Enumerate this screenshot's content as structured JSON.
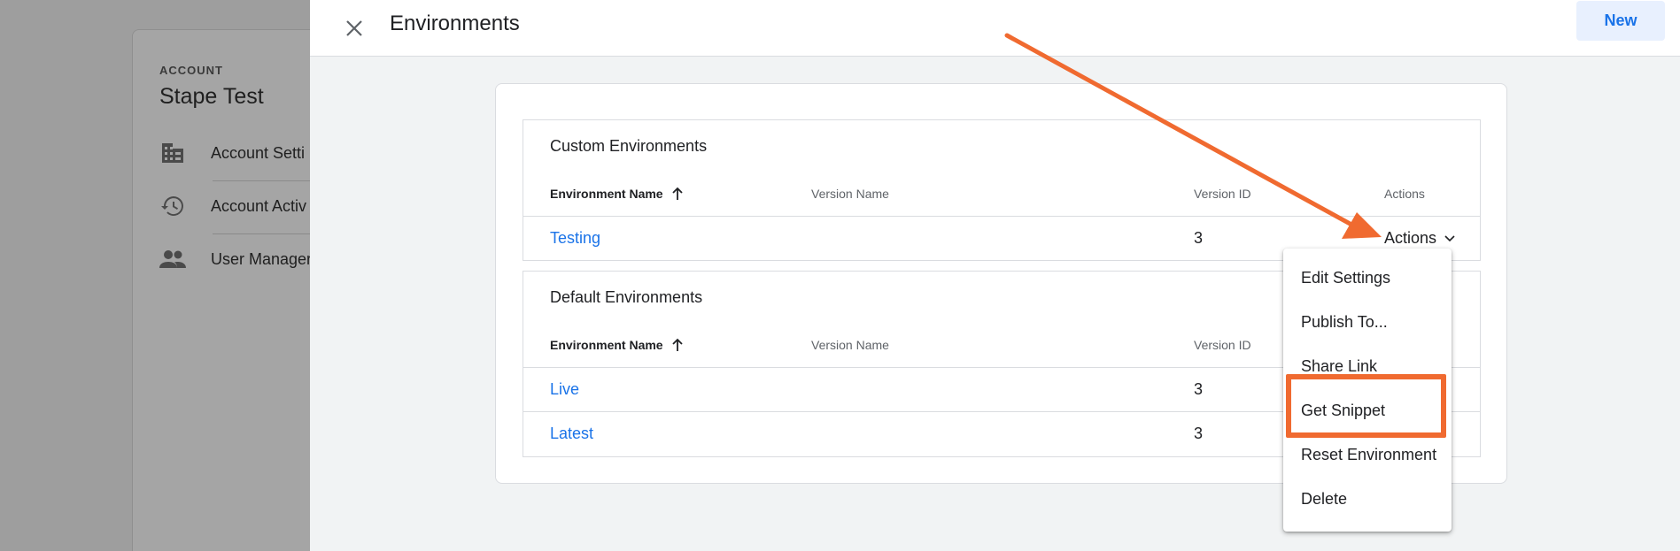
{
  "account": {
    "label": "ACCOUNT",
    "name": "Stape Test",
    "nav": [
      {
        "label": "Account Setti",
        "icon": "building-icon"
      },
      {
        "label": "Account Activ",
        "icon": "history-icon"
      },
      {
        "label": "User Manager",
        "icon": "people-icon"
      }
    ]
  },
  "panel": {
    "title": "Environments",
    "new_label": "New"
  },
  "custom": {
    "title": "Custom Environments",
    "headers": {
      "name": "Environment Name",
      "version_name": "Version Name",
      "version_id": "Version ID",
      "actions": "Actions"
    },
    "rows": [
      {
        "name": "Testing",
        "version_id": "3",
        "actions": "Actions"
      }
    ]
  },
  "default": {
    "title": "Default Environments",
    "headers": {
      "name": "Environment Name",
      "version_name": "Version Name",
      "version_id": "Version ID"
    },
    "rows": [
      {
        "name": "Live",
        "version_id": "3"
      },
      {
        "name": "Latest",
        "version_id": "3"
      }
    ]
  },
  "menu": {
    "items": [
      "Edit Settings",
      "Publish To...",
      "Share Link",
      "Get Snippet",
      "Reset Environment",
      "Delete"
    ]
  },
  "colors": {
    "accent": "#1a73e8",
    "highlight": "#f06a30"
  }
}
